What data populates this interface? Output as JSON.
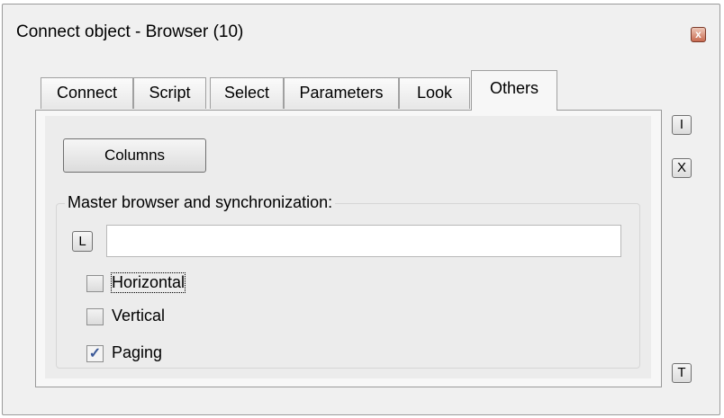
{
  "window": {
    "title": "Connect object - Browser (10)",
    "close_glyph": "x"
  },
  "tabs": [
    {
      "label": "Connect",
      "active": false
    },
    {
      "label": "Script",
      "active": false
    },
    {
      "label": "Select",
      "active": false
    },
    {
      "label": "Parameters",
      "active": false
    },
    {
      "label": "Look",
      "active": false
    },
    {
      "label": "Others",
      "active": true
    }
  ],
  "others": {
    "columns_button": "Columns",
    "group_label": "Master browser and synchronization:",
    "lookup_button": "L",
    "master_browser_value": "",
    "checkboxes": [
      {
        "label": "Horizontal",
        "checked": false
      },
      {
        "label": "Vertical",
        "checked": false
      },
      {
        "label": "Paging",
        "checked": true
      }
    ]
  },
  "side_buttons": {
    "insert": "I",
    "delete": "X",
    "test": "T"
  },
  "colors": {
    "window_bg": "#f0f0f0",
    "close_accent": "#c86a50",
    "check_mark": "#3b5998"
  }
}
